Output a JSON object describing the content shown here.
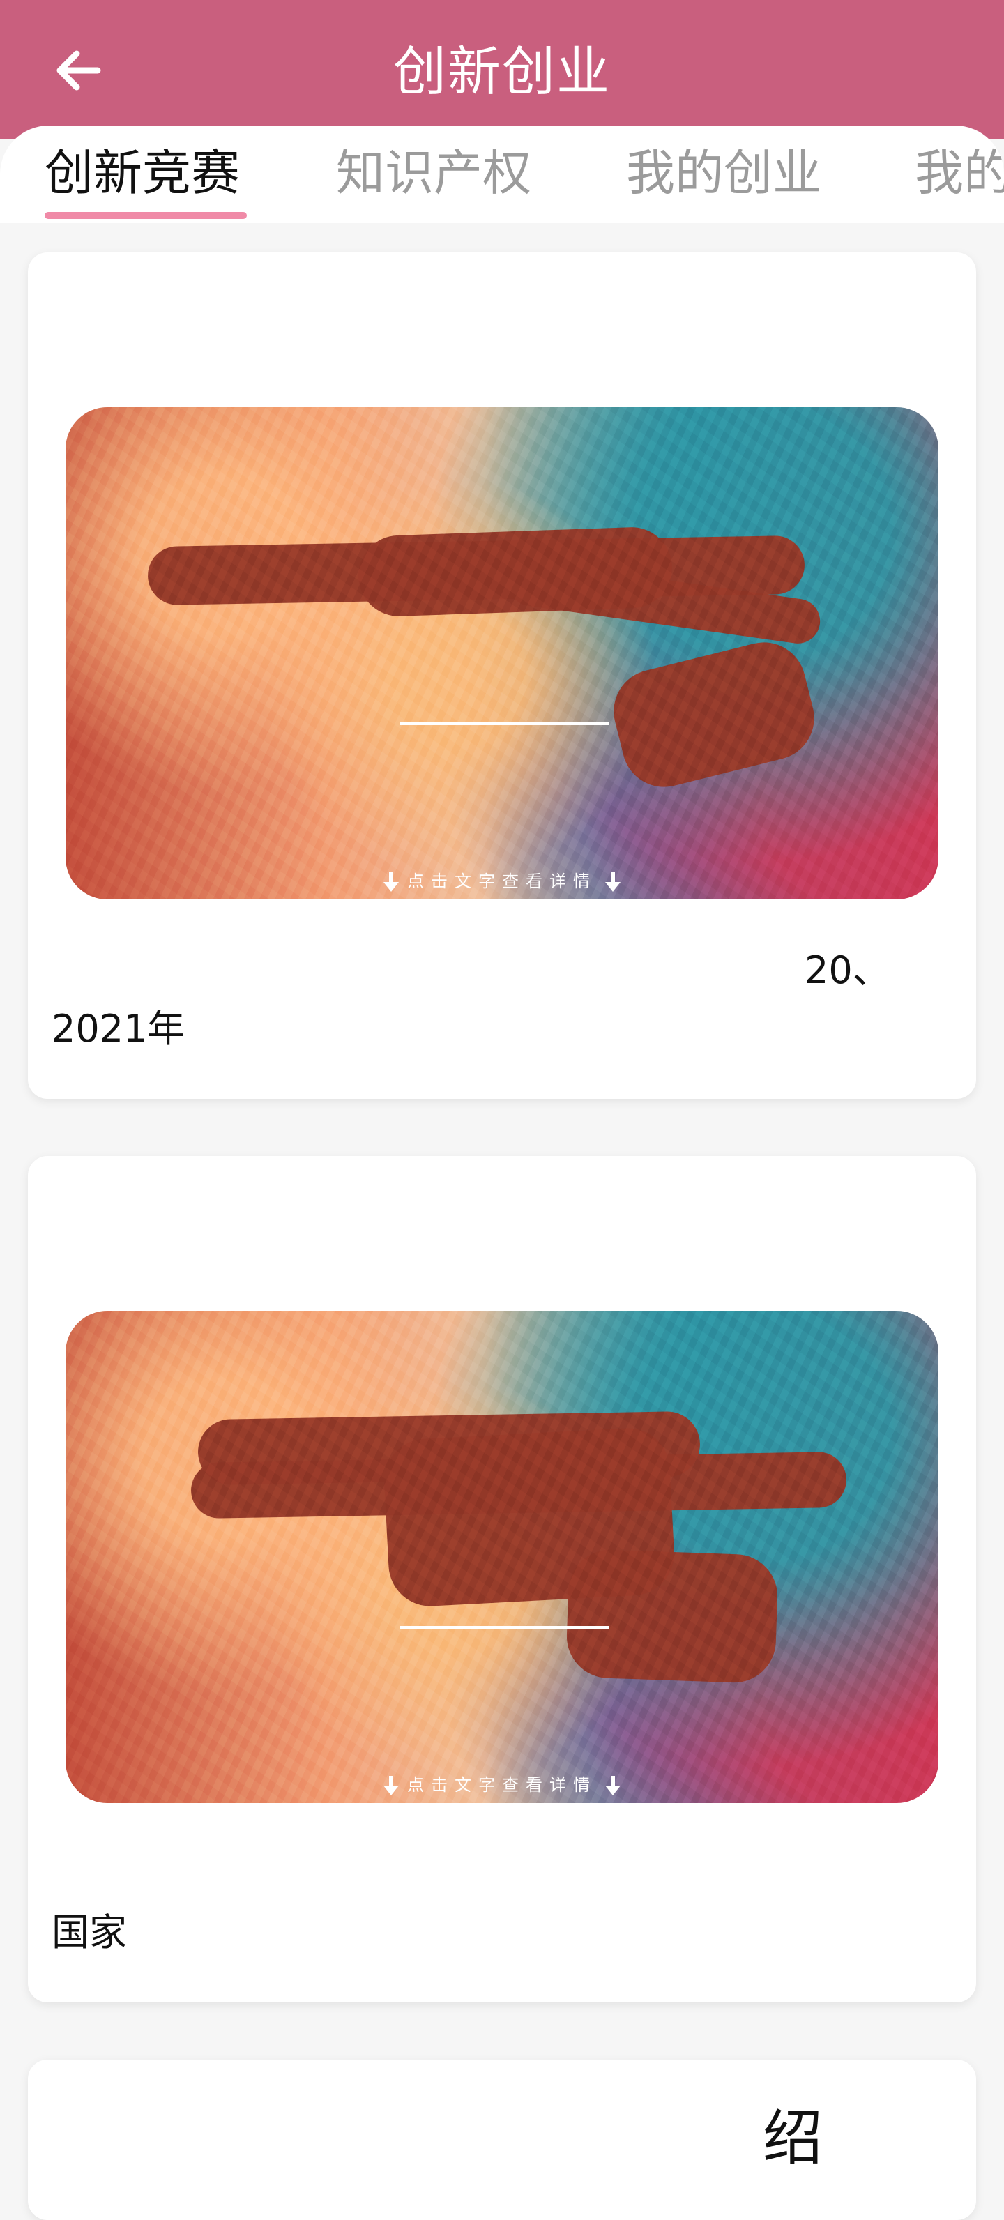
{
  "header": {
    "title": "创新创业"
  },
  "tabs": [
    {
      "label": "创新竞赛",
      "active": true
    },
    {
      "label": "知识产权",
      "active": false
    },
    {
      "label": "我的创业",
      "active": false
    },
    {
      "label": "我的",
      "active": false
    }
  ],
  "cards": [
    {
      "hint": "点击文字查看详情",
      "text_line1": "",
      "text_line2": "2021年",
      "text_fragment_right": "20、"
    },
    {
      "hint": "点击文字查看详情",
      "text_line1": "",
      "text_line2": "国家",
      "text_fragment_right": ""
    },
    {
      "title_fragment": "绍"
    }
  ]
}
